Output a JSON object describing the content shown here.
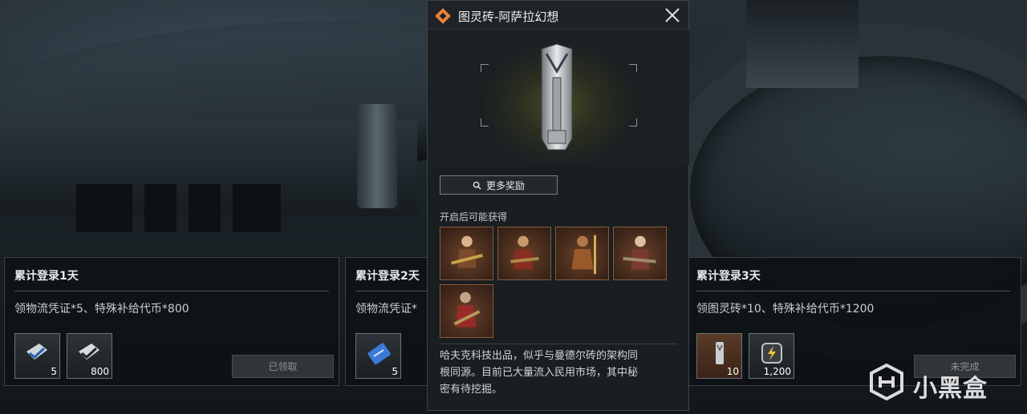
{
  "popup": {
    "title": "图灵砖-阿萨拉幻想",
    "more_rewards_label": "更多奖励",
    "possible_label": "开启后可能获得",
    "rewards": [
      "character-1",
      "character-2",
      "character-3",
      "character-4",
      "character-5"
    ],
    "description_lines": [
      "哈夫克科技出品，似乎与曼德尔砖的架构同",
      "根同源。目前已大量流入民用市场，其中秘",
      "密有待挖掘。"
    ]
  },
  "cards": [
    {
      "title": "累计登录1天",
      "desc": "领物流凭证*5、特殊补给代币*800",
      "items": [
        {
          "icon": "voucher-icon",
          "count": "5"
        },
        {
          "icon": "token-icon",
          "count": "800"
        }
      ],
      "button_label": "已领取"
    },
    {
      "title": "累计登录2天",
      "desc": "领物流凭证*",
      "items": [
        {
          "icon": "ticket-icon",
          "count": "5"
        }
      ]
    },
    {
      "title": "累计登录3天",
      "desc": "领图灵砖*10、特殊补给代币*1200",
      "items": [
        {
          "icon": "turing-brick-icon",
          "count": "10"
        },
        {
          "icon": "lightning-token-icon",
          "count": "1,200"
        }
      ],
      "button_label": "未完成"
    }
  ],
  "watermark": {
    "text": "小黑盒"
  },
  "colors": {
    "accent_orange": "#e8823a",
    "card_bg": "#0e1215",
    "reward_border": "#8a5a3c"
  }
}
